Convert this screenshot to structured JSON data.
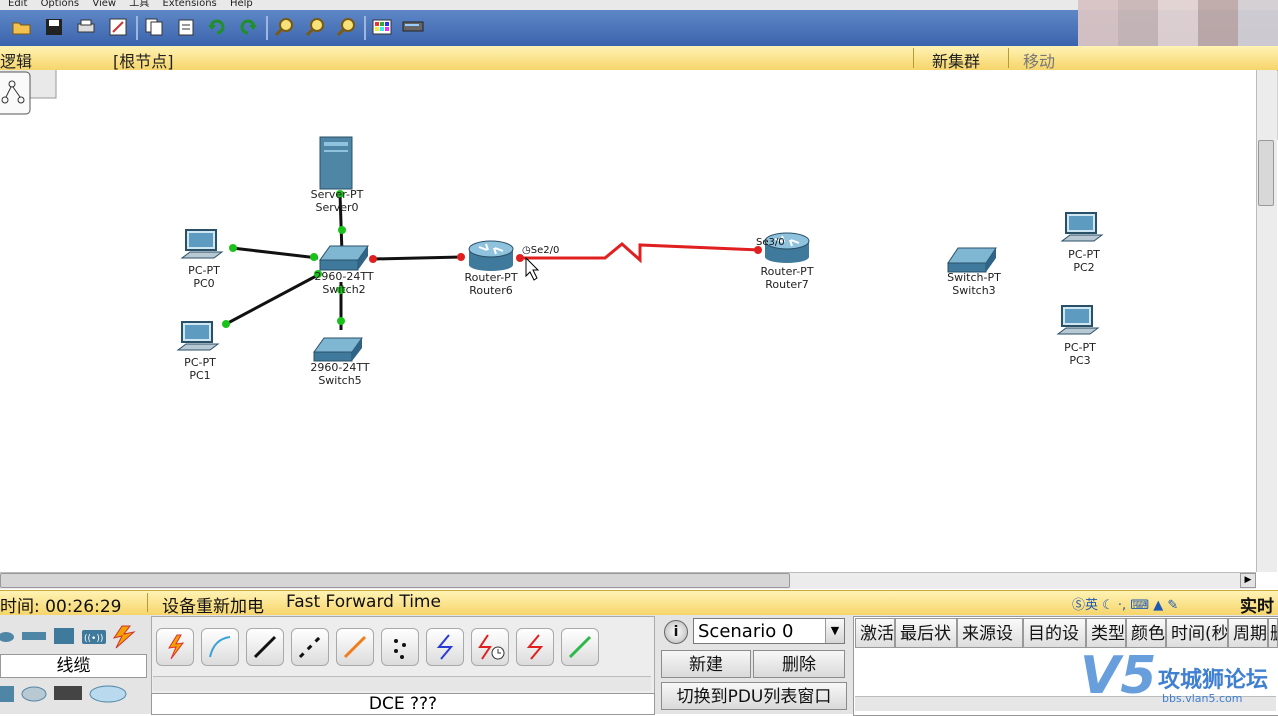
{
  "menu": {
    "items": [
      "Edit",
      "Options",
      "View",
      "工具",
      "Extensions",
      "Help"
    ]
  },
  "logic_bar": {
    "mode": "逻辑",
    "root": "[根节点]",
    "new_cluster": "新集群",
    "move": "移动"
  },
  "devices": [
    {
      "type": "Server-PT",
      "name": "Server0"
    },
    {
      "type": "2960-24TT",
      "name": "Switch2"
    },
    {
      "type": "PC-PT",
      "name": "PC0"
    },
    {
      "type": "PC-PT",
      "name": "PC1"
    },
    {
      "type": "2960-24TT",
      "name": "Switch5"
    },
    {
      "type": "Router-PT",
      "name": "Router6"
    },
    {
      "type": "Router-PT",
      "name": "Router7"
    },
    {
      "type": "Switch-PT",
      "name": "Switch3"
    },
    {
      "type": "PC-PT",
      "name": "PC2"
    },
    {
      "type": "PC-PT",
      "name": "PC3"
    }
  ],
  "ports": {
    "router6_serial": "Se2/0",
    "router7_serial": "Se3/0"
  },
  "status": {
    "time_label": "时间: 00:26:29",
    "power_cycle": "设备重新加电",
    "fast_forward": "Fast Forward Time",
    "realtime": "实时"
  },
  "device_panel": {
    "category_label": "线缆"
  },
  "cable_panel": {
    "selected_label": "DCE ???"
  },
  "scenario": {
    "selected": "Scenario 0",
    "new_button": "新建",
    "delete_button": "删除",
    "toggle_pdu": "切换到PDU列表窗口"
  },
  "pdu_table": {
    "columns": [
      "激活",
      "最后状",
      "来源设",
      "目的设",
      "类型",
      "颜色",
      "时间(秒",
      "周期",
      "删"
    ]
  },
  "watermark": {
    "brand": "V5",
    "name": "攻城狮论坛",
    "url": "bbs.vlan5.com"
  },
  "colors": {
    "serial_link": "#e02020",
    "up_port": "#19c219",
    "down_port": "#e02020",
    "accent_yellow": "#f6d56a"
  }
}
